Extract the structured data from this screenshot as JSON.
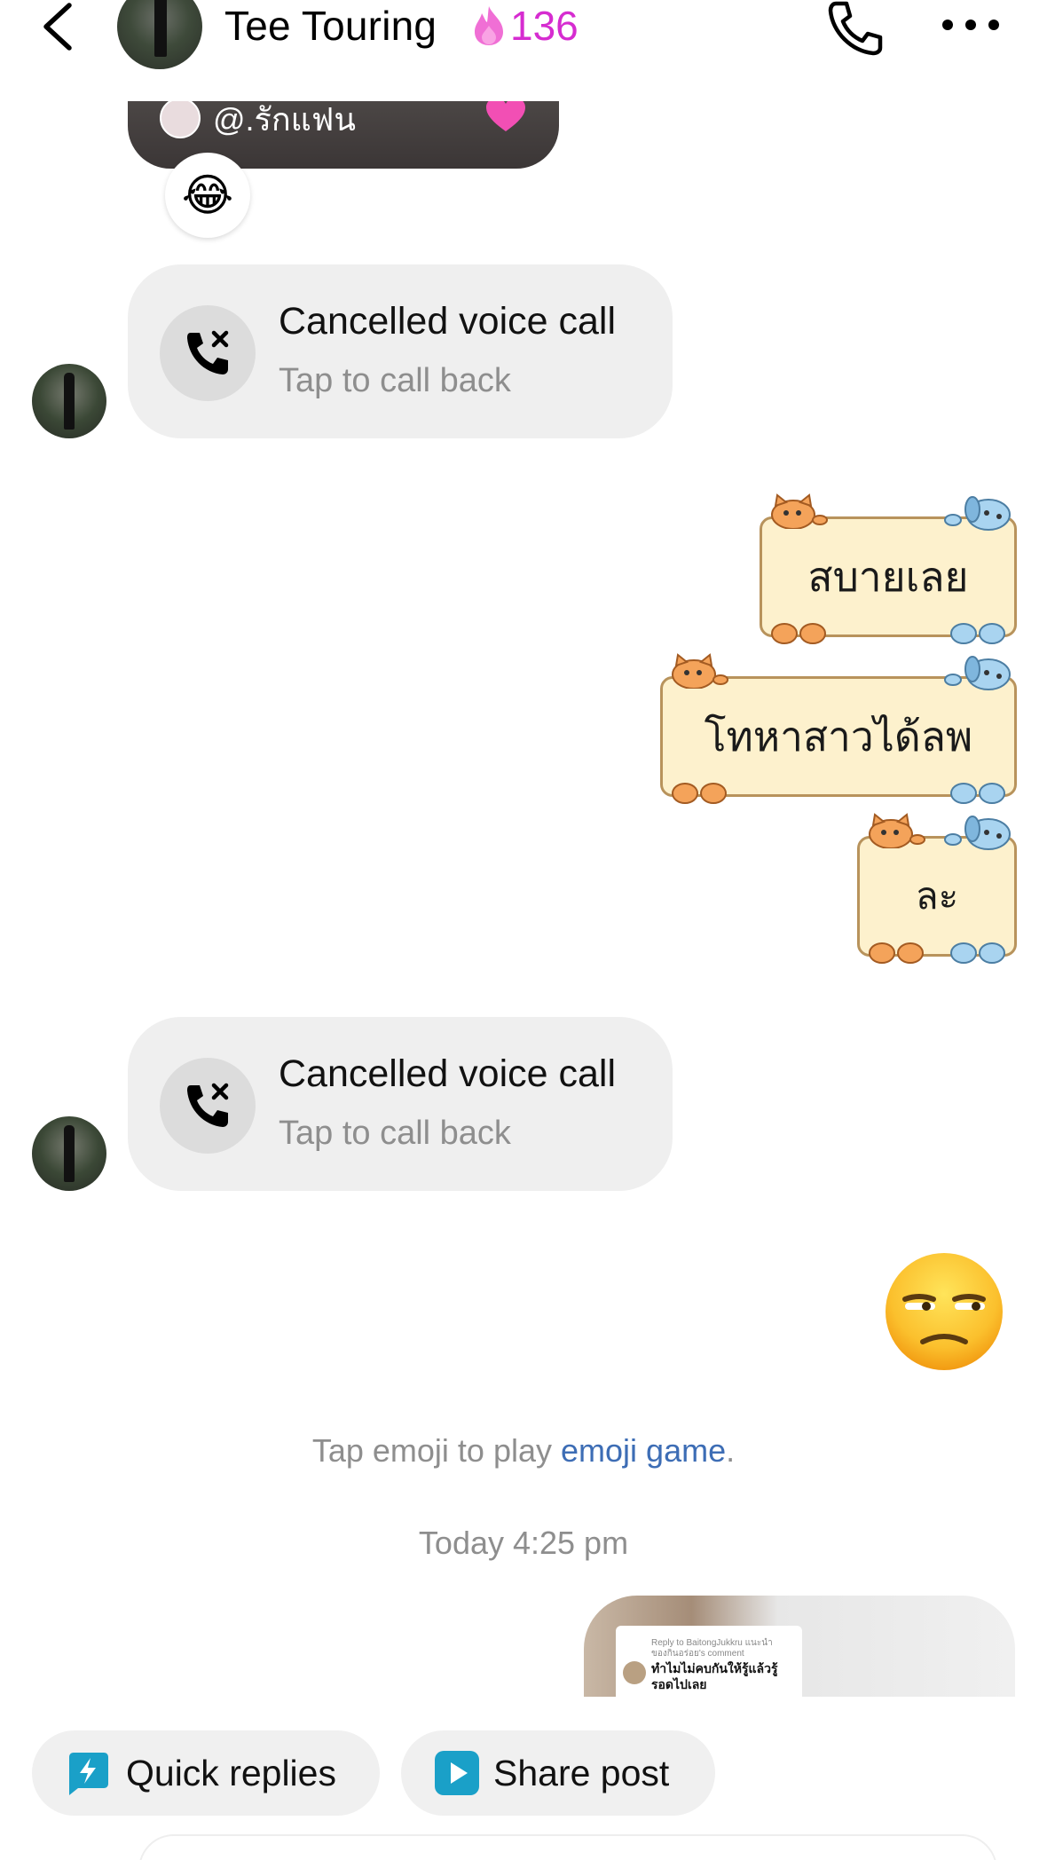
{
  "header": {
    "title": "Tee Touring",
    "streak_count": "136",
    "back_icon": "chevron-left-icon",
    "call_icon": "phone-icon",
    "more_icon": "more-horizontal-icon"
  },
  "shared_post": {
    "mention": "@.รักแฟน"
  },
  "reaction": {
    "emoji": "😂"
  },
  "messages": [
    {
      "type": "call",
      "title": "Cancelled voice call",
      "subtitle": "Tap to call back"
    },
    {
      "type": "sticker",
      "text": "สบายเลย"
    },
    {
      "type": "sticker",
      "text": "โทหาสาวได้ลพ"
    },
    {
      "type": "sticker",
      "text": "ละ"
    },
    {
      "type": "call",
      "title": "Cancelled voice call",
      "subtitle": "Tap to call back"
    },
    {
      "type": "emoji",
      "emoji": "unamused-face"
    }
  ],
  "hint": {
    "prefix": "Tap emoji to play ",
    "link": "emoji game",
    "suffix": "."
  },
  "timestamp": "Today 4:25 pm",
  "reel_preview": {
    "reply_line1": "Reply to BaitongJukkru แนะนำ",
    "reply_line2": "ของกินอร่อย's comment",
    "comment": "ทำไมไม่คบกันให้รู้แล้วรู้รอดไปเลย"
  },
  "quick_actions": [
    {
      "label": "Quick replies",
      "icon": "lightning-bolt-icon"
    },
    {
      "label": "Share post",
      "icon": "play-icon"
    }
  ],
  "colors": {
    "streak": "#d62cd0",
    "link": "#3d6db5",
    "chip_icon": "#1aa0c8",
    "bubble": "#efefef"
  }
}
